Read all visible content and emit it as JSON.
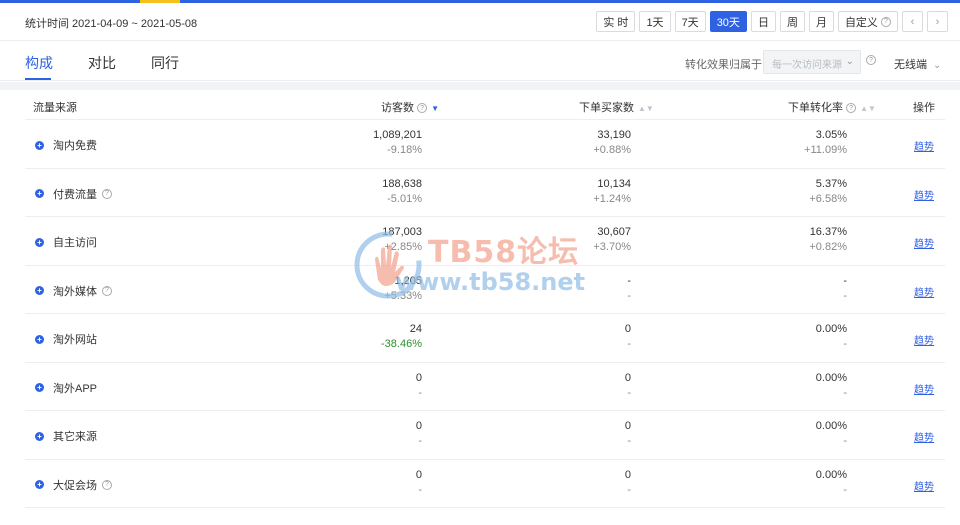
{
  "date_range": {
    "label": "统计时间 2021-04-09 ~ 2021-05-08",
    "buttons": [
      {
        "label": "实 时",
        "active": false
      },
      {
        "label": "1天",
        "active": false
      },
      {
        "label": "7天",
        "active": false
      },
      {
        "label": "30天",
        "active": true
      },
      {
        "label": "日",
        "active": false
      },
      {
        "label": "周",
        "active": false
      },
      {
        "label": "月",
        "active": false
      },
      {
        "label": "自定义",
        "active": false
      }
    ]
  },
  "tabs": [
    {
      "label": "构成",
      "active": true
    },
    {
      "label": "对比",
      "active": false
    },
    {
      "label": "同行",
      "active": false
    }
  ],
  "conversion": {
    "label": "转化效果归属于：",
    "select_value": "每一次访问来源",
    "device": "无线端"
  },
  "table": {
    "headers": {
      "source": "流量来源",
      "visitors": "访客数",
      "buyers": "下单买家数",
      "rate": "下单转化率",
      "action": "操作"
    },
    "rows": [
      {
        "name": "淘内免费",
        "help": false,
        "visitors": "1,089,201",
        "visitors_delta": "-9.18%",
        "buyers": "33,190",
        "buyers_delta": "+0.88%",
        "rate": "3.05%",
        "rate_delta": "+11.09%",
        "action": "趋势"
      },
      {
        "name": "付费流量",
        "help": true,
        "visitors": "188,638",
        "visitors_delta": "-5.01%",
        "buyers": "10,134",
        "buyers_delta": "+1.24%",
        "rate": "5.37%",
        "rate_delta": "+6.58%",
        "action": "趋势"
      },
      {
        "name": "自主访问",
        "help": false,
        "visitors": "187,003",
        "visitors_delta": "+2.85%",
        "buyers": "30,607",
        "buyers_delta": "+3.70%",
        "rate": "16.37%",
        "rate_delta": "+0.82%",
        "action": "趋势"
      },
      {
        "name": "淘外媒体",
        "help": true,
        "visitors": "1,205",
        "visitors_delta": "+5.33%",
        "buyers": "-",
        "buyers_delta": "-",
        "rate": "-",
        "rate_delta": "-",
        "action": "趋势"
      },
      {
        "name": "淘外网站",
        "help": false,
        "visitors": "24",
        "visitors_delta": "-38.46%",
        "buyers": "0",
        "buyers_delta": "-",
        "rate": "0.00%",
        "rate_delta": "-",
        "action": "趋势"
      },
      {
        "name": "淘外APP",
        "help": false,
        "visitors": "0",
        "visitors_delta": "-",
        "buyers": "0",
        "buyers_delta": "-",
        "rate": "0.00%",
        "rate_delta": "-",
        "action": "趋势"
      },
      {
        "name": "其它来源",
        "help": false,
        "visitors": "0",
        "visitors_delta": "-",
        "buyers": "0",
        "buyers_delta": "-",
        "rate": "0.00%",
        "rate_delta": "-",
        "action": "趋势"
      },
      {
        "name": "大促会场",
        "help": true,
        "visitors": "0",
        "visitors_delta": "-",
        "buyers": "0",
        "buyers_delta": "-",
        "rate": "0.00%",
        "rate_delta": "-",
        "action": "趋势"
      }
    ]
  },
  "watermark": {
    "title": "TB58论坛",
    "url": "www.tb58.net"
  },
  "colors": {
    "accent": "#2f62e3",
    "negative": "#2f8f2f",
    "watermark_orange": "#f3a28c",
    "watermark_blue": "#8fbde8"
  }
}
